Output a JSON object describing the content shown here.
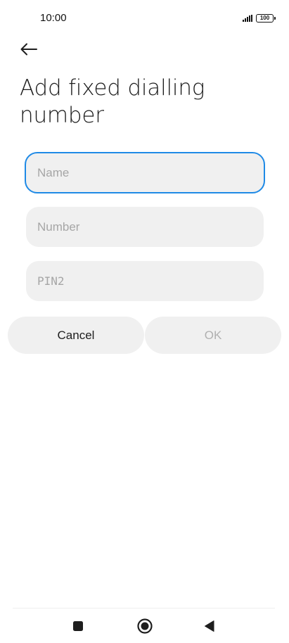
{
  "status_bar": {
    "time": "10:00",
    "battery_level": "100"
  },
  "header": {
    "back_icon": "arrow-left-icon",
    "title": "Add fixed dialling number"
  },
  "form": {
    "name_placeholder": "Name",
    "name_value": "",
    "number_placeholder": "Number",
    "number_value": "",
    "pin2_placeholder": "PIN2",
    "pin2_value": ""
  },
  "actions": {
    "cancel_label": "Cancel",
    "ok_label": "OK"
  },
  "nav_bar": {
    "recents_icon": "square-icon",
    "home_icon": "circle-icon",
    "back_icon": "triangle-back-icon"
  },
  "colors": {
    "accent": "#1f8ae6",
    "field_background": "#f0f0f0",
    "placeholder": "#a6a6a6",
    "disabled_text": "#b0b0b0"
  }
}
